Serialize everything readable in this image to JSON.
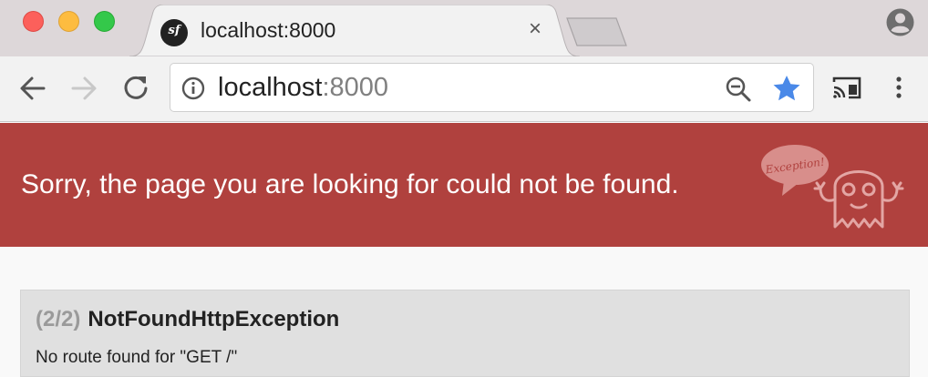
{
  "window": {
    "tab_title": "localhost:8000",
    "favicon_letters": "sf",
    "tab_close_glyph": "×"
  },
  "toolbar": {
    "url_host": "localhost",
    "url_port": ":8000"
  },
  "icons": {
    "back": "arrow-left-icon",
    "forward": "arrow-right-icon",
    "reload": "reload-icon",
    "info": "info-icon",
    "zoom": "zoom-out-icon",
    "bookmark": "star-icon",
    "cast": "cast-icon",
    "menu": "kebab-menu-icon",
    "profile": "profile-icon"
  },
  "colors": {
    "banner": "#b0413e",
    "star": "#4a89e8",
    "exception_box": "#e0e0e0"
  },
  "banner": {
    "message": "Sorry, the page you are looking for could not be found.",
    "illustration_text": "Exception!"
  },
  "exception": {
    "counter": "(2/2)",
    "class_name": "NotFoundHttpException",
    "message": "No route found for \"GET /\""
  }
}
